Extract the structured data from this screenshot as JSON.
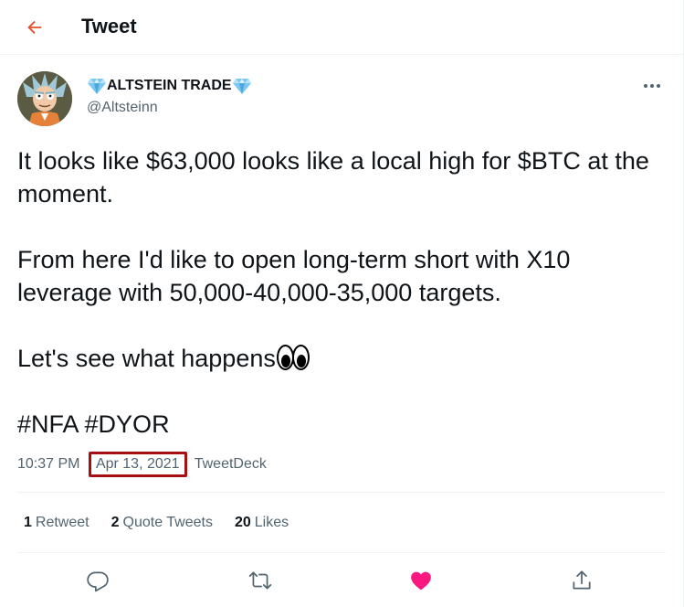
{
  "header": {
    "title": "Tweet",
    "back_icon": "arrow-left-icon",
    "accent_color": "#e0522b"
  },
  "author": {
    "display_name": "ALTSTEIN TRADE",
    "handle": "@Altsteinn",
    "avatar_icon": "avatar-rick",
    "badge_icon": "gem-emoji"
  },
  "tweet": {
    "paragraphs": [
      "It looks like $63,000 looks like a local high for $BTC at the moment.",
      "From here I'd like to open long-term short with X10 leverage with 50,000-40,000-35,000 targets.",
      "Let's see what happens",
      "#NFA #DYOR"
    ],
    "emoji_after_p3": "eyes-emoji",
    "time": "10:37 PM",
    "date": "Apr 13, 2021",
    "source": "TweetDeck",
    "highlight_color": "#a50f0f"
  },
  "stats": {
    "retweets_count": "1",
    "retweets_label": "Retweet",
    "quotes_count": "2",
    "quotes_label": "Quote Tweets",
    "likes_count": "20",
    "likes_label": "Likes"
  },
  "actions": {
    "reply_icon": "reply-icon",
    "retweet_icon": "retweet-icon",
    "like_icon": "heart-icon",
    "like_color": "#f91880",
    "share_icon": "share-icon",
    "icon_color": "#536471"
  }
}
